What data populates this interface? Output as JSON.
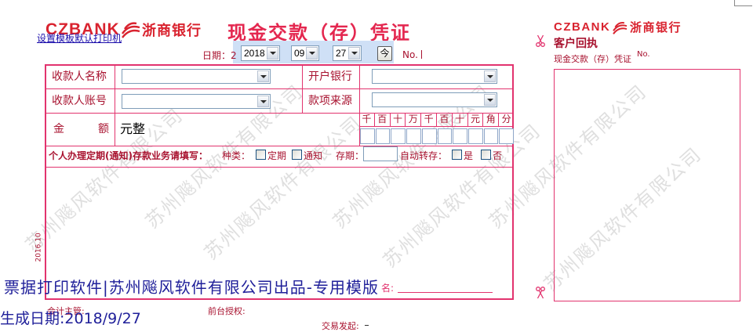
{
  "toolbar": {
    "printer_link": "设置模板默认打印机"
  },
  "logo": {
    "brand": "CZBANK",
    "name": "浙商银行"
  },
  "header": {
    "title": "现金交款（存）凭证",
    "date_label": "日期：2",
    "year": "2018",
    "month": "09",
    "day": "27",
    "today_button": "今",
    "number_label": "No."
  },
  "form": {
    "payee_name_label": "收款人名称",
    "payee_account_label": "收款人账号",
    "bank_label": "开户银行",
    "source_label": "款项来源",
    "amount_label_left": "金",
    "amount_label_right": "额",
    "amount_text": "元整",
    "digit_headers": [
      "千",
      "百",
      "十",
      "万",
      "千",
      "百",
      "十",
      "元",
      "角",
      "分"
    ],
    "deposit_note": "个人办理定期(通知)存款业务请填写：",
    "type_label": "种类：",
    "type_fixed": "定期",
    "type_notice": "通知",
    "term_label": "存期：",
    "auto_renew_label": "自动转存：",
    "auto_yes": "是",
    "auto_no": "否",
    "edition": "2016.10",
    "signature_tail": "名:"
  },
  "footer": {
    "accounting_supervisor": "会计主管:",
    "front_desk_auth": "前台授权:",
    "transaction_initiator": "交易发起:"
  },
  "overlay": {
    "software_banner": "票据打印软件|苏州飚风软件有限公司出品-专用模版",
    "generated_date": "生成日期:2018/9/27"
  },
  "receipt": {
    "brand": "CZBANK",
    "name": "浙商银行",
    "title": "客户回执",
    "subtitle": "现金交款（存）凭证",
    "number_label": "No."
  },
  "watermark_text": "苏州飚风软件有限公司",
  "colors": {
    "frame": "#e2336e",
    "label": "#a8122f",
    "title": "#e4274f",
    "brand": "#d9232f",
    "overlay_text": "#20209a",
    "link": "#1a0dab"
  }
}
